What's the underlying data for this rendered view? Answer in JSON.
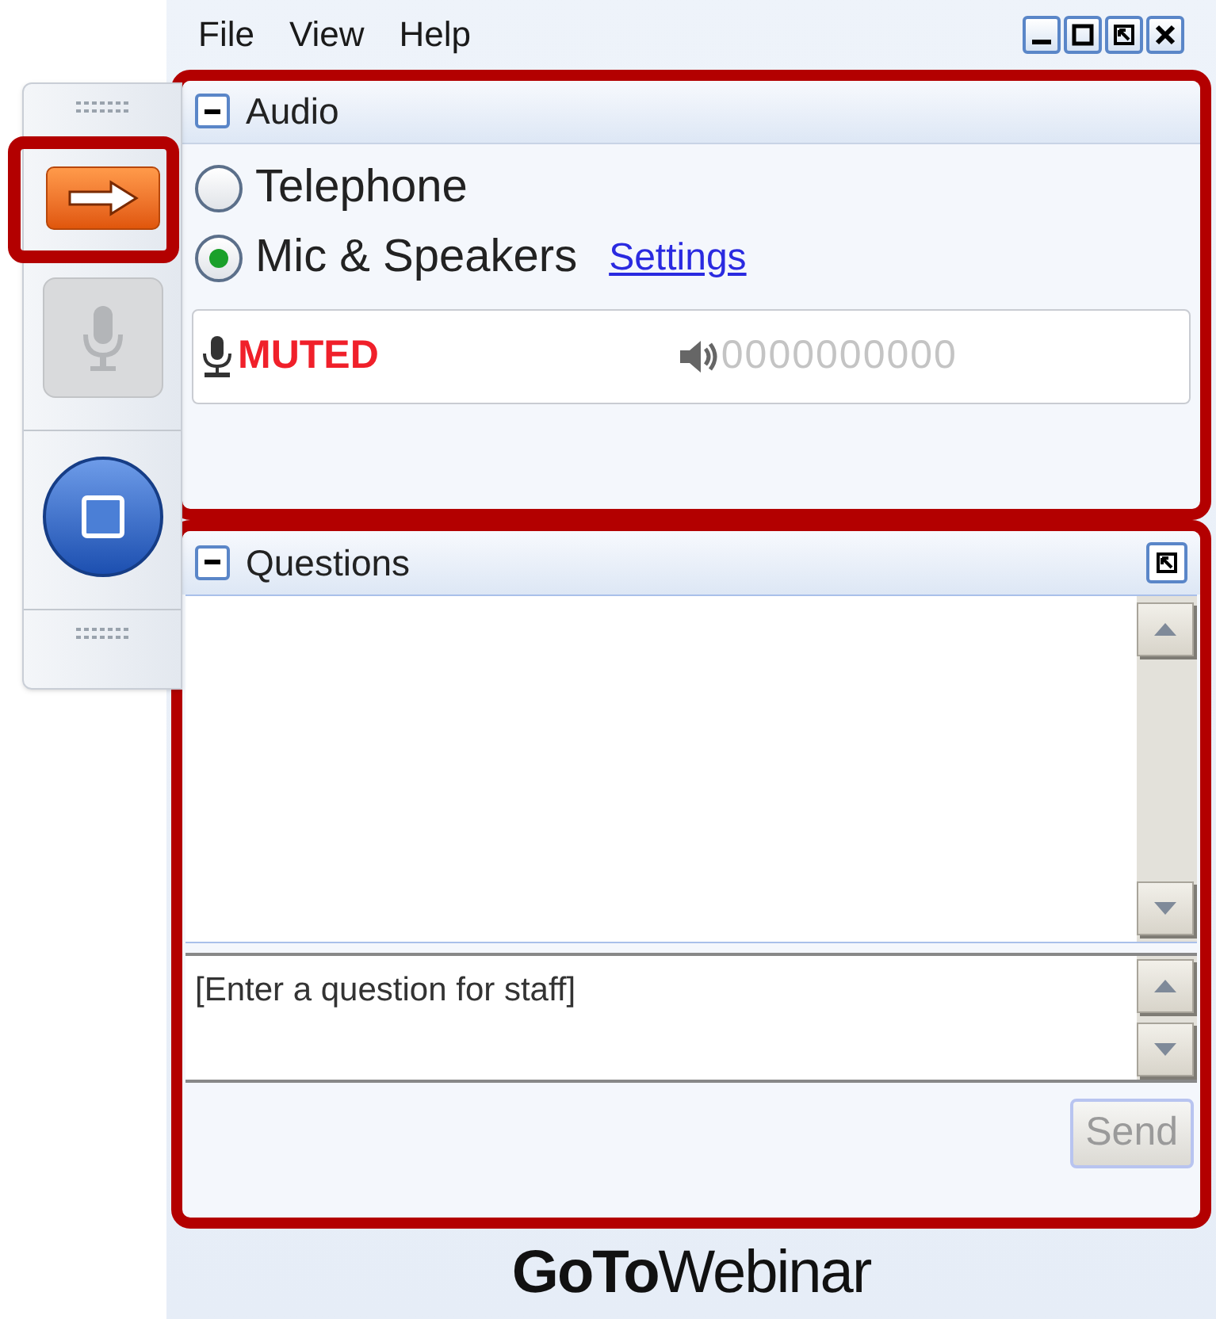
{
  "menu": [
    "File",
    "View",
    "Help"
  ],
  "audio": {
    "title": "Audio",
    "options": [
      {
        "label": "Telephone",
        "selected": false
      },
      {
        "label": "Mic & Speakers",
        "selected": true
      }
    ],
    "settings_link": "Settings",
    "mic_status": "MUTED",
    "speaker_meter": "0000000000"
  },
  "questions": {
    "title": "Questions",
    "input": {
      "placeholder": "[Enter a question for staff]"
    },
    "send_button": {
      "label": "Send",
      "disabled": true
    }
  },
  "logo": "**GoTo**Webinar"
}
